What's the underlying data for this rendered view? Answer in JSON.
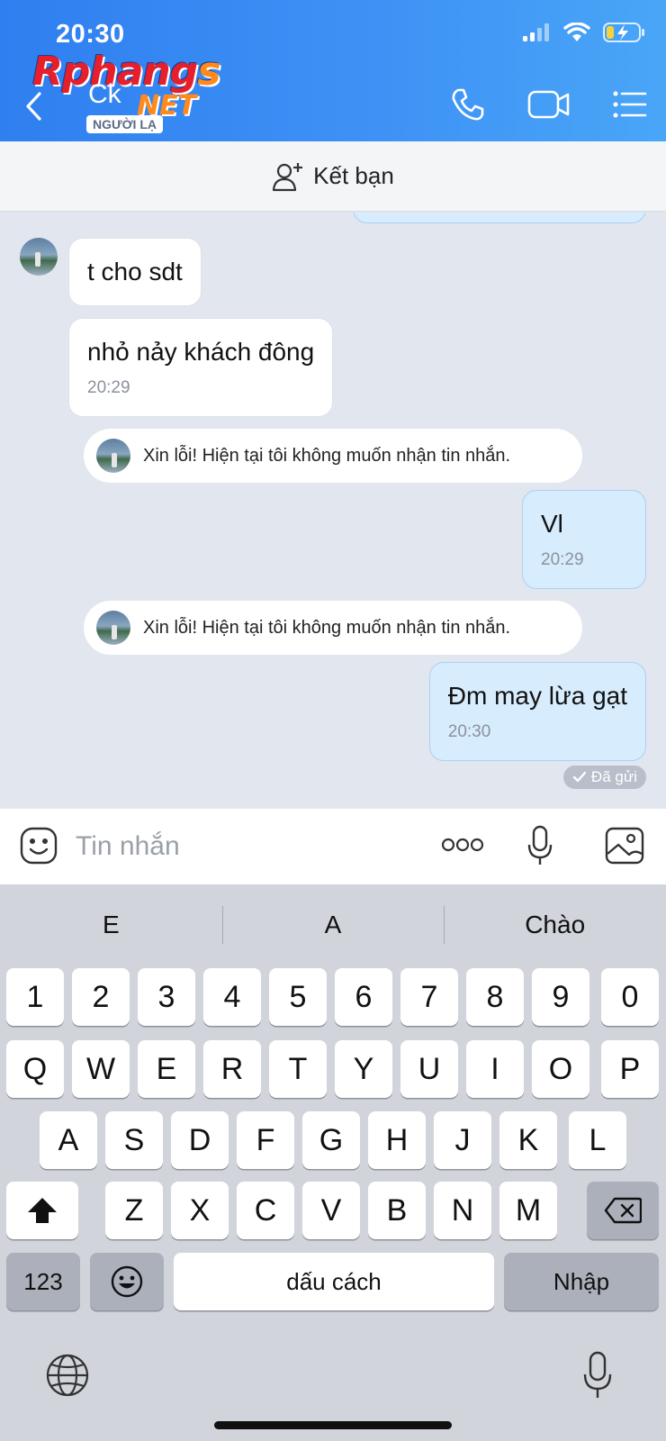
{
  "status_bar": {
    "time": "20:30"
  },
  "watermark": {
    "part1": "Rphang",
    "part2": "s",
    "part3": "NET"
  },
  "header": {
    "contact_name": "Ck",
    "badge": "NGƯỜI LẠ",
    "icons": [
      "back-chevron-icon",
      "phone-icon",
      "video-icon",
      "menu-list-icon"
    ]
  },
  "friend_bar": {
    "label": "Kết bạn"
  },
  "messages": {
    "m1": {
      "text": "t cho sdt"
    },
    "m2": {
      "text": "nhỏ nảy khách đông",
      "time": "20:29"
    },
    "sys1": {
      "text": "Xin lỗi! Hiện tại tôi không muốn nhận tin nhắn."
    },
    "m3": {
      "text": "Vl",
      "time": "20:29"
    },
    "sys2": {
      "text": "Xin lỗi! Hiện tại tôi không muốn nhận tin nhắn."
    },
    "m4": {
      "text": "Đm may lừa gạt",
      "time": "20:30"
    },
    "sent_status": "Đã gửi"
  },
  "composer": {
    "placeholder": "Tin nhắn"
  },
  "keyboard": {
    "suggestions": [
      "E",
      "A",
      "Chào"
    ],
    "row_numbers": [
      "1",
      "2",
      "3",
      "4",
      "5",
      "6",
      "7",
      "8",
      "9",
      "0"
    ],
    "row_q": [
      "Q",
      "W",
      "E",
      "R",
      "T",
      "Y",
      "U",
      "I",
      "O",
      "P"
    ],
    "row_a": [
      "A",
      "S",
      "D",
      "F",
      "G",
      "H",
      "J",
      "K",
      "L"
    ],
    "row_z": [
      "Z",
      "X",
      "C",
      "V",
      "B",
      "N",
      "M"
    ],
    "key_123": "123",
    "space": "dấu cách",
    "enter": "Nhập"
  },
  "colors": {
    "header_blue": "#3a8cf3",
    "sent_bubble": "#d7ecfd",
    "chat_bg": "#e2e6ef"
  }
}
